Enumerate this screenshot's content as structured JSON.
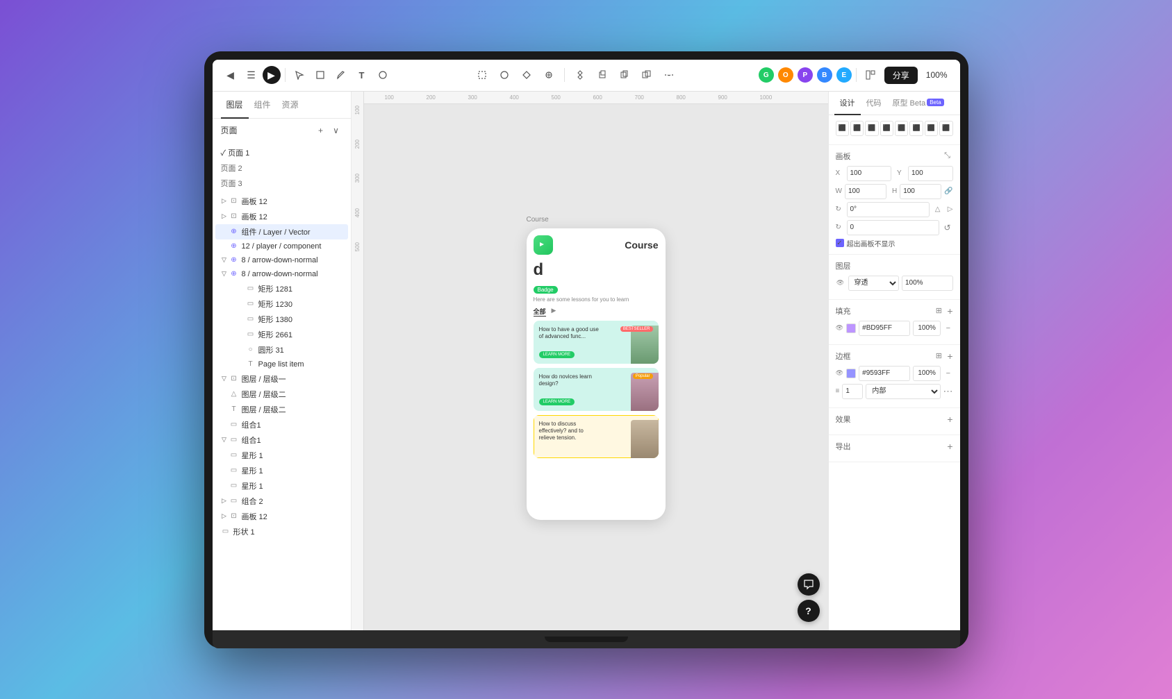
{
  "background": "linear-gradient(135deg, #7b4fd4, #5bbce4, #c06fd4, #e07fd4)",
  "toolbar": {
    "share_label": "分享",
    "zoom_label": "100%",
    "back_icon": "◀",
    "menu_icon": "☰",
    "play_icon": "▶"
  },
  "left_panel": {
    "tabs": [
      "图层",
      "组件",
      "资源"
    ],
    "active_tab": "图层",
    "pages_label": "页面",
    "pages": [
      {
        "label": "页面 1",
        "active": true
      },
      {
        "label": "页面 2",
        "active": false
      },
      {
        "label": "页面 3",
        "active": false
      }
    ],
    "layers": [
      {
        "label": "画板 12",
        "indent": 0,
        "type": "frame",
        "expanded": false
      },
      {
        "label": "画板 12",
        "indent": 0,
        "type": "frame",
        "expanded": false
      },
      {
        "label": "组件 / Layer / Vector",
        "indent": 0,
        "type": "component",
        "expanded": false,
        "selected": true
      },
      {
        "label": "12 / player / component",
        "indent": 0,
        "type": "component",
        "expanded": false
      },
      {
        "label": "8 / arrow-down-normal",
        "indent": 0,
        "type": "component",
        "expanded": true
      },
      {
        "label": "8 / arrow-down-normal",
        "indent": 0,
        "type": "component",
        "expanded": true
      },
      {
        "label": "矩形 1281",
        "indent": 3,
        "type": "rect"
      },
      {
        "label": "矩形 1230",
        "indent": 3,
        "type": "rect"
      },
      {
        "label": "矩形 1380",
        "indent": 3,
        "type": "rect"
      },
      {
        "label": "矩形 2661",
        "indent": 3,
        "type": "rect"
      },
      {
        "label": "圆形 31",
        "indent": 3,
        "type": "ellipse"
      },
      {
        "label": "Page list item",
        "indent": 3,
        "type": "text"
      },
      {
        "label": "图层 / 层级一",
        "indent": 0,
        "type": "frame",
        "expanded": true
      },
      {
        "label": "图层 / 层级二",
        "indent": 1,
        "type": "path"
      },
      {
        "label": "图层 / 层级二",
        "indent": 1,
        "type": "text"
      },
      {
        "label": "组合1",
        "indent": 1,
        "type": "group"
      },
      {
        "label": "组合1",
        "indent": 0,
        "type": "group",
        "expanded": true
      },
      {
        "label": "星形 1",
        "indent": 1,
        "type": "rect"
      },
      {
        "label": "星形 1",
        "indent": 1,
        "type": "rect"
      },
      {
        "label": "星形 1",
        "indent": 1,
        "type": "rect"
      },
      {
        "label": "组合 2",
        "indent": 0,
        "type": "group"
      },
      {
        "label": "画板 12",
        "indent": 0,
        "type": "frame"
      },
      {
        "label": "形状 1",
        "indent": 0,
        "type": "rect"
      }
    ]
  },
  "canvas": {
    "frame_label": "Course",
    "phone": {
      "title": "Course",
      "logo_letter": "d",
      "badge_text": "Badge",
      "subtitle": "Here are some lessons\nfor you to learn",
      "tabs": [
        "全部",
        "▶"
      ],
      "courses": [
        {
          "title": "How to have a good use of advanced func...",
          "bg": "teal",
          "btn_label": "LEARN MORE",
          "tag": "BESTSELLER"
        },
        {
          "title": "How do novices learn design?",
          "bg": "teal",
          "btn_label": "LEARN MORE",
          "tag": "Popular"
        },
        {
          "title": "How to discuss effectively? and to relieve tension.",
          "bg": "yellow",
          "btn_label": "",
          "tag": ""
        }
      ]
    }
  },
  "right_panel": {
    "tabs": [
      "设计",
      "代码",
      "原型 Beta"
    ],
    "active_tab": "设计",
    "frame_section": {
      "label": "画板",
      "x": "100",
      "y": "100",
      "w": "100",
      "h": "100",
      "rotation": "0°",
      "radius": "0",
      "overflow_label": "超出画板不显示"
    },
    "layer_section": {
      "label": "图层",
      "blend_mode": "穿透",
      "opacity": "100%"
    },
    "fill_section": {
      "label": "填充",
      "color": "#BD95FF",
      "opacity": "100%"
    },
    "stroke_section": {
      "label": "边框",
      "color": "#9593FF",
      "opacity": "100%",
      "width": "1",
      "type": "内部"
    },
    "effect_section": {
      "label": "效果"
    },
    "export_section": {
      "label": "导出"
    }
  }
}
